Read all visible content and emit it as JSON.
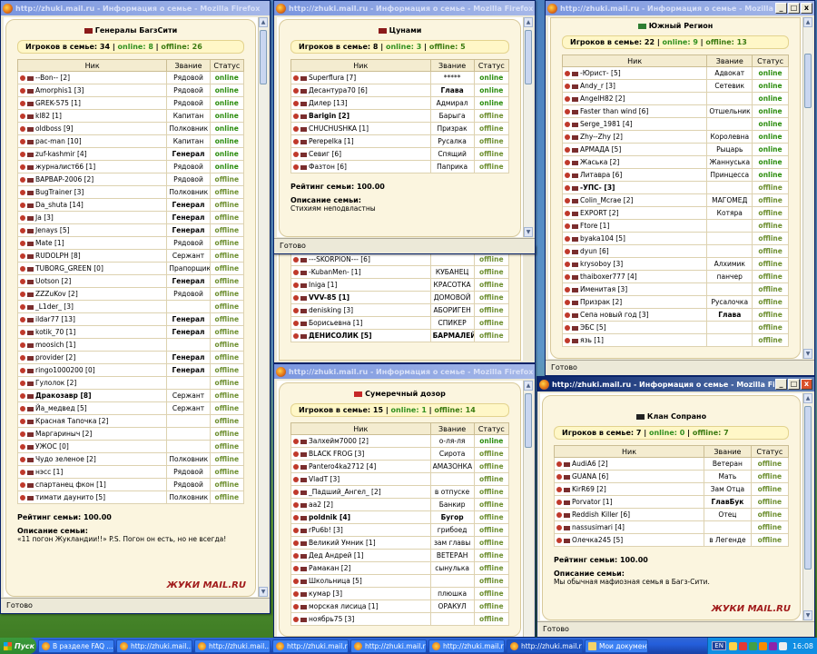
{
  "windows": {
    "w1": {
      "title": "http://zhuki.mail.ru - Информация о семье - Mozilla Firefox",
      "family": "Генералы БагзСити",
      "total": "Игроков в семье: 34",
      "online": "online: 8",
      "offline": "offline: 26",
      "headers": [
        "Ник",
        "Звание",
        "Статус"
      ],
      "rows": [
        {
          "nick": "--Bon-- [2]",
          "rank": "Рядовой",
          "status": "online"
        },
        {
          "nick": "Amorphis1 [3]",
          "rank": "Рядовой",
          "status": "online"
        },
        {
          "nick": "GREK-575 [1]",
          "rank": "Рядовой",
          "status": "online"
        },
        {
          "nick": "kl82 [1]",
          "rank": "Капитан",
          "status": "online"
        },
        {
          "nick": "oldboss [9]",
          "rank": "Полковник",
          "status": "online"
        },
        {
          "nick": "pac-man [10]",
          "rank": "Капитан",
          "status": "online"
        },
        {
          "nick": "zuf-kashmir [4]",
          "rank": "Генерал",
          "status": "online"
        },
        {
          "nick": "журналист66 [1]",
          "rank": "Рядовой",
          "status": "online"
        },
        {
          "nick": "BAPBAP-2006 [2]",
          "rank": "Рядовой",
          "status": "offline"
        },
        {
          "nick": "BugTrainer [3]",
          "rank": "Полковник",
          "status": "offline"
        },
        {
          "nick": "Da_shuta [14]",
          "rank": "Генерал",
          "status": "offline"
        },
        {
          "nick": "Ja [3]",
          "rank": "Генерал",
          "status": "offline"
        },
        {
          "nick": "Jenays [5]",
          "rank": "Генерал",
          "status": "offline"
        },
        {
          "nick": "Mate [1]",
          "rank": "Рядовой",
          "status": "offline"
        },
        {
          "nick": "RUDOLPH [8]",
          "rank": "Сержант",
          "status": "offline"
        },
        {
          "nick": "TUBORG_GREEN [0]",
          "rank": "Прапорщик",
          "status": "offline"
        },
        {
          "nick": "Uotson [2]",
          "rank": "Генерал",
          "status": "offline"
        },
        {
          "nick": "ZZZuKov [2]",
          "rank": "Рядовой",
          "status": "offline"
        },
        {
          "nick": "_L1der_ [3]",
          "rank": "",
          "status": "offline"
        },
        {
          "nick": "ildar77 [13]",
          "rank": "Генерал",
          "status": "offline"
        },
        {
          "nick": "kotik_70 [1]",
          "rank": "Генерал",
          "status": "offline"
        },
        {
          "nick": "moosich [1]",
          "rank": "",
          "status": "offline"
        },
        {
          "nick": "provider [2]",
          "rank": "Генерал",
          "status": "offline"
        },
        {
          "nick": "ringo1000200 [0]",
          "rank": "Генерал",
          "status": "offline"
        },
        {
          "nick": "Гулолок [2]",
          "rank": "",
          "status": "offline"
        },
        {
          "nick": "Дракозавр [8]",
          "rank": "Сержант",
          "status": "offline"
        },
        {
          "nick": "Йа_медвед [5]",
          "rank": "Сержант",
          "status": "offline"
        },
        {
          "nick": "Красная Тапочка [2]",
          "rank": "",
          "status": "offline"
        },
        {
          "nick": "Маргариныч [2]",
          "rank": "",
          "status": "offline"
        },
        {
          "nick": "УЖОС [0]",
          "rank": "",
          "status": "offline"
        },
        {
          "nick": "Чудо зеленое [2]",
          "rank": "Полковник",
          "status": "offline"
        },
        {
          "nick": "нэсс [1]",
          "rank": "Рядовой",
          "status": "offline"
        },
        {
          "nick": "спартанец фкон [1]",
          "rank": "Рядовой",
          "status": "offline"
        },
        {
          "nick": "тимати даунито [5]",
          "rank": "Полковник",
          "status": "offline"
        }
      ],
      "rating": "Рейтинг семьи: 100.00",
      "desc_label": "Описание семьи:",
      "desc": "«11 погон Жукландии!!» P.S. Погон он есть, но не всегда!",
      "logo": "ЖУКИ MAIL.RU",
      "status": "Готово"
    },
    "w2": {
      "title": "http://zhuki.mail.ru - Информация о семье - Mozilla Firefox",
      "family": "Цунами",
      "total": "Игроков в семье: 8",
      "online": "online: 3",
      "offline": "offline: 5",
      "headers": [
        "Ник",
        "Звание",
        "Статус"
      ],
      "rows": [
        {
          "nick": "Superflura [7]",
          "rank": "*****",
          "status": "online"
        },
        {
          "nick": "Десантура70 [6]",
          "rank": "Глава",
          "status": "online"
        },
        {
          "nick": "Дилер [13]",
          "rank": "Адмирал",
          "status": "online"
        },
        {
          "nick": "Barigin [2]",
          "rank": "Барыга",
          "status": "offline"
        },
        {
          "nick": "CHUCHUSHKA [1]",
          "rank": "Призрак",
          "status": "offline"
        },
        {
          "nick": "Perepelka [1]",
          "rank": "Русалка",
          "status": "offline"
        },
        {
          "nick": "Севиг [6]",
          "rank": "Спящий",
          "status": "offline"
        },
        {
          "nick": "Фазтон [6]",
          "rank": "Паприка",
          "status": "offline"
        }
      ],
      "rating": "Рейтинг семьи: 100.00",
      "desc_label": "Описание семьи:",
      "desc": "Стихиям неподвластны",
      "status": "Готово"
    },
    "w3": {
      "rows": [
        {
          "nick": "---SKORPION--- [6]",
          "rank": "",
          "status": "offline"
        },
        {
          "nick": "-KubanMen- [1]",
          "rank": "КУБАНЕЦ",
          "status": "offline"
        },
        {
          "nick": "Iniga [1]",
          "rank": "КРАСОТКА",
          "status": "offline"
        },
        {
          "nick": "VVV-85 [1]",
          "rank": "ДОМОВОЙ",
          "status": "offline"
        },
        {
          "nick": "denisking [3]",
          "rank": "АБОРИГЕН",
          "status": "offline"
        },
        {
          "nick": "Борисьевна [1]",
          "rank": "СПИКЕР",
          "status": "offline"
        },
        {
          "nick": "ДЕНИСОЛИК [5]",
          "rank": "БАРМАЛЕЙ",
          "status": "offline"
        }
      ]
    },
    "w4": {
      "title": "http://zhuki.mail.ru - Информация о семье - Mozilla Firefox",
      "family": "Южный Регион",
      "total": "Игроков в семье: 22",
      "online": "online: 9",
      "offline": "offline: 13",
      "headers": [
        "Ник",
        "Звание",
        "Статус"
      ],
      "rows": [
        {
          "nick": "-Юрист- [5]",
          "rank": "Адвокат",
          "status": "online"
        },
        {
          "nick": "Andy_r [3]",
          "rank": "Сетевик",
          "status": "online"
        },
        {
          "nick": "AngelH82 [2]",
          "rank": "",
          "status": "online"
        },
        {
          "nick": "Faster than wind [6]",
          "rank": "Отшельник",
          "status": "online"
        },
        {
          "nick": "Serge_1981 [4]",
          "rank": "",
          "status": "online"
        },
        {
          "nick": "Zhy--Zhy [2]",
          "rank": "Королевна",
          "status": "online"
        },
        {
          "nick": "АРМАДА [5]",
          "rank": "Рыцарь",
          "status": "online"
        },
        {
          "nick": "Жаська [2]",
          "rank": "Жаннуська",
          "status": "online"
        },
        {
          "nick": "Литавра [6]",
          "rank": "Принцесса",
          "status": "online"
        },
        {
          "nick": "-УПС- [3]",
          "rank": "",
          "status": "offline"
        },
        {
          "nick": "Colin_Mcrae [2]",
          "rank": "МАГОМЕД",
          "status": "offline"
        },
        {
          "nick": "EXPORT [2]",
          "rank": "Котяра",
          "status": "offline"
        },
        {
          "nick": "Ftore [1]",
          "rank": "",
          "status": "offline"
        },
        {
          "nick": "byaka104 [5]",
          "rank": "",
          "status": "offline"
        },
        {
          "nick": "dyun [6]",
          "rank": "",
          "status": "offline"
        },
        {
          "nick": "krysoboy [3]",
          "rank": "Алхимик",
          "status": "offline"
        },
        {
          "nick": "thaiboxer777 [4]",
          "rank": "панчер",
          "status": "offline"
        },
        {
          "nick": "Именитая [3]",
          "rank": "",
          "status": "offline"
        },
        {
          "nick": "Призрак [2]",
          "rank": "Русалочка",
          "status": "offline"
        },
        {
          "nick": "Сепа новый год [3]",
          "rank": "Глава",
          "status": "offline"
        },
        {
          "nick": "ЭБС [5]",
          "rank": "",
          "status": "offline"
        },
        {
          "nick": "язь [1]",
          "rank": "",
          "status": "offline"
        }
      ],
      "status": "Готово"
    },
    "w5": {
      "title": "http://zhuki.mail.ru - Информация о семье - Mozilla Firefox",
      "family": "Сумеречный дозор",
      "total": "Игроков в семье: 15",
      "online": "online: 1",
      "offline": "offline: 14",
      "headers": [
        "Ник",
        "Звание",
        "Статус"
      ],
      "rows": [
        {
          "nick": "Залхейм7000 [2]",
          "rank": "о-ля-ля",
          "status": "online"
        },
        {
          "nick": "BLACK FROG [3]",
          "rank": "Сирота",
          "status": "offline"
        },
        {
          "nick": "Pantero4ka2712 [4]",
          "rank": "АМАЗОНКА",
          "status": "offline"
        },
        {
          "nick": "VladT [3]",
          "rank": "",
          "status": "offline"
        },
        {
          "nick": "_Падший_Ангел_ [2]",
          "rank": "в отпуске",
          "status": "offline"
        },
        {
          "nick": "aa2 [2]",
          "rank": "Банкир",
          "status": "offline"
        },
        {
          "nick": "poldnik [4]",
          "rank": "Бугор",
          "status": "offline"
        },
        {
          "nick": "rPu6b! [3]",
          "rank": "грибоед",
          "status": "offline"
        },
        {
          "nick": "Великий Умник [1]",
          "rank": "зам главы",
          "status": "offline"
        },
        {
          "nick": "Дед Андрей [1]",
          "rank": "ВЕТЕРАН",
          "status": "offline"
        },
        {
          "nick": "Рамакан [2]",
          "rank": "сынулька",
          "status": "offline"
        },
        {
          "nick": "Школьница [5]",
          "rank": "",
          "status": "offline"
        },
        {
          "nick": "кумар [3]",
          "rank": "плюшка",
          "status": "offline"
        },
        {
          "nick": "морская лисица [1]",
          "rank": "ОРАКУЛ",
          "status": "offline"
        },
        {
          "nick": "ноябрь75 [3]",
          "rank": "",
          "status": "offline"
        }
      ]
    },
    "w6": {
      "title": "http://zhuki.mail.ru - Информация о семье - Mozilla Firefox",
      "family": "Клан Сопрано",
      "total": "Игроков в семье: 7",
      "online": "online: 0",
      "offline": "offline: 7",
      "headers": [
        "Ник",
        "Звание",
        "Статус"
      ],
      "rows": [
        {
          "nick": "AudiA6 [2]",
          "rank": "Ветеран",
          "status": "offline"
        },
        {
          "nick": "GUANA [6]",
          "rank": "Мать",
          "status": "offline"
        },
        {
          "nick": "KirR69 [2]",
          "rank": "Зам Отца",
          "status": "offline"
        },
        {
          "nick": "Porvator [1]",
          "rank": "ГлавБук",
          "status": "offline"
        },
        {
          "nick": "Reddish Killer [6]",
          "rank": "Отец",
          "status": "offline"
        },
        {
          "nick": "nassusimari [4]",
          "rank": "",
          "status": "offline"
        },
        {
          "nick": "Олечка245 [5]",
          "rank": "в Легенде",
          "status": "offline"
        }
      ],
      "rating": "Рейтинг семьи: 100.00",
      "desc_label": "Описание семьи:",
      "desc": "Мы обычная мафиозная семья в Багз-Сити.",
      "logo": "ЖУКИ MAIL.RU",
      "status": "Готово"
    }
  },
  "taskbar": {
    "start": "Пуск",
    "items": [
      "В разделе FAQ ...",
      "http://zhuki.mail....",
      "http://zhuki.mail....",
      "http://zhuki.mail.r...",
      "http://zhuki.mail.r...",
      "http://zhuki.mail.r...",
      "http://zhuki.mail.r...",
      "Мои документы"
    ],
    "lang": "EN",
    "clock": "16:08"
  }
}
